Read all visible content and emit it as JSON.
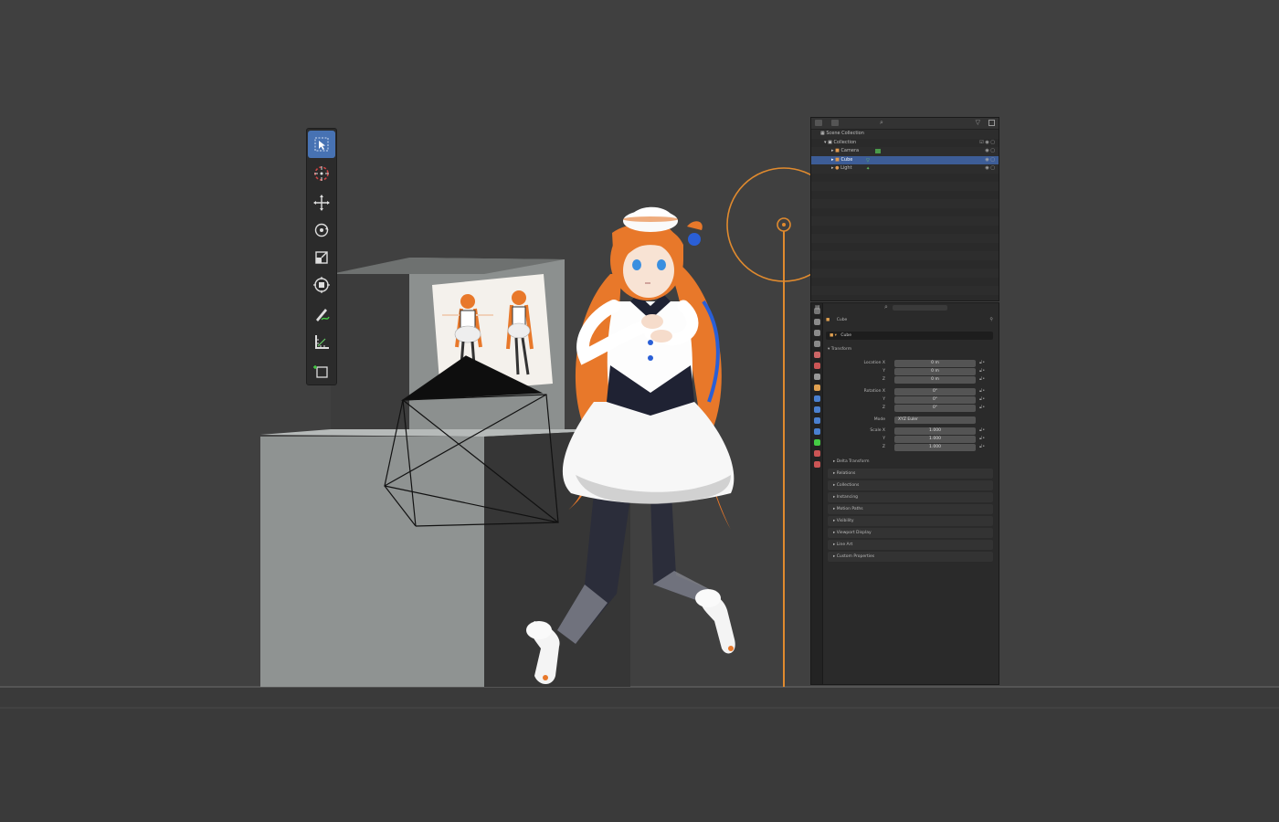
{
  "colors": {
    "viewport_bg": "#404040",
    "accent": "#4772b3",
    "selection": "#3d5d97",
    "light_orange": "#e08a2e",
    "camera_wire": "#111111"
  },
  "toolbar": {
    "tools": [
      {
        "name": "select-box-icon",
        "active": true
      },
      {
        "name": "cursor-icon",
        "active": false
      },
      {
        "name": "move-icon",
        "active": false
      },
      {
        "name": "rotate-icon",
        "active": false
      },
      {
        "name": "scale-icon",
        "active": false
      },
      {
        "name": "transform-icon",
        "active": false
      },
      {
        "name": "annotate-icon",
        "active": false
      },
      {
        "name": "measure-icon",
        "active": false
      },
      {
        "name": "add-cube-icon",
        "active": false
      }
    ]
  },
  "outliner": {
    "root": "Scene Collection",
    "collection": "Collection",
    "items": [
      {
        "label": "Camera",
        "selected": false
      },
      {
        "label": "Cube",
        "selected": true
      },
      {
        "label": "Light",
        "selected": false
      }
    ]
  },
  "properties": {
    "object_name": "Cube",
    "object_data": "Cube",
    "transform_header": "Transform",
    "location_label": "Location X",
    "rotation_label": "Rotation X",
    "mode_label": "Mode",
    "mode_value": "XYZ Euler",
    "scale_label": "Scale X",
    "axis_y": "Y",
    "axis_z": "Z",
    "location": [
      "0 m",
      "0 m",
      "0 m"
    ],
    "rotation": [
      "0°",
      "0°",
      "0°"
    ],
    "scale": [
      "1.000",
      "1.000",
      "1.000"
    ],
    "delta": "Delta Transform",
    "sections": [
      "Relations",
      "Collections",
      "Instancing",
      "Motion Paths",
      "Visibility",
      "Viewport Display",
      "Line Art",
      "Custom Properties"
    ]
  }
}
